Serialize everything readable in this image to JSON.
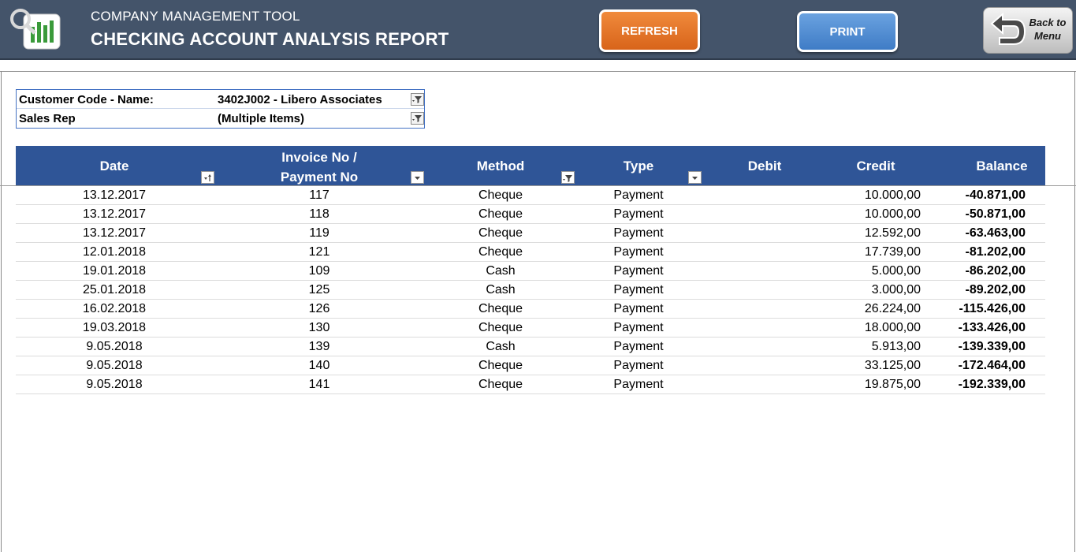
{
  "header": {
    "app_title": "COMPANY MANAGEMENT TOOL",
    "report_title": "CHECKING ACCOUNT ANALYSIS REPORT",
    "refresh_label": "REFRESH",
    "print_label": "PRINT",
    "back_label_1": "Back to",
    "back_label_2": "Menu",
    "colors": {
      "bar": "#44546a",
      "refresh": "#e8762b",
      "print": "#4f8ad6",
      "table_header": "#2f5597"
    }
  },
  "filters": [
    {
      "key": "Customer Code - Name:",
      "value": "3402J002 - Libero Associates"
    },
    {
      "key": "Sales Rep",
      "value": "(Multiple Items)"
    }
  ],
  "table": {
    "columns": {
      "date": "Date",
      "invoice_1": "Invoice No /",
      "invoice_2": "Payment No",
      "method": "Method",
      "type": "Type",
      "debit": "Debit",
      "credit": "Credit",
      "balance": "Balance"
    },
    "rows": [
      {
        "date": "13.12.2017",
        "inv": "117",
        "method": "Cheque",
        "type": "Payment",
        "debit": "",
        "credit": "10.000,00",
        "balance": "-40.871,00"
      },
      {
        "date": "13.12.2017",
        "inv": "118",
        "method": "Cheque",
        "type": "Payment",
        "debit": "",
        "credit": "10.000,00",
        "balance": "-50.871,00"
      },
      {
        "date": "13.12.2017",
        "inv": "119",
        "method": "Cheque",
        "type": "Payment",
        "debit": "",
        "credit": "12.592,00",
        "balance": "-63.463,00"
      },
      {
        "date": "12.01.2018",
        "inv": "121",
        "method": "Cheque",
        "type": "Payment",
        "debit": "",
        "credit": "17.739,00",
        "balance": "-81.202,00"
      },
      {
        "date": "19.01.2018",
        "inv": "109",
        "method": "Cash",
        "type": "Payment",
        "debit": "",
        "credit": "5.000,00",
        "balance": "-86.202,00"
      },
      {
        "date": "25.01.2018",
        "inv": "125",
        "method": "Cash",
        "type": "Payment",
        "debit": "",
        "credit": "3.000,00",
        "balance": "-89.202,00"
      },
      {
        "date": "16.02.2018",
        "inv": "126",
        "method": "Cheque",
        "type": "Payment",
        "debit": "",
        "credit": "26.224,00",
        "balance": "-115.426,00"
      },
      {
        "date": "19.03.2018",
        "inv": "130",
        "method": "Cheque",
        "type": "Payment",
        "debit": "",
        "credit": "18.000,00",
        "balance": "-133.426,00"
      },
      {
        "date": "9.05.2018",
        "inv": "139",
        "method": "Cash",
        "type": "Payment",
        "debit": "",
        "credit": "5.913,00",
        "balance": "-139.339,00"
      },
      {
        "date": "9.05.2018",
        "inv": "140",
        "method": "Cheque",
        "type": "Payment",
        "debit": "",
        "credit": "33.125,00",
        "balance": "-172.464,00"
      },
      {
        "date": "9.05.2018",
        "inv": "141",
        "method": "Cheque",
        "type": "Payment",
        "debit": "",
        "credit": "19.875,00",
        "balance": "-192.339,00"
      }
    ]
  }
}
